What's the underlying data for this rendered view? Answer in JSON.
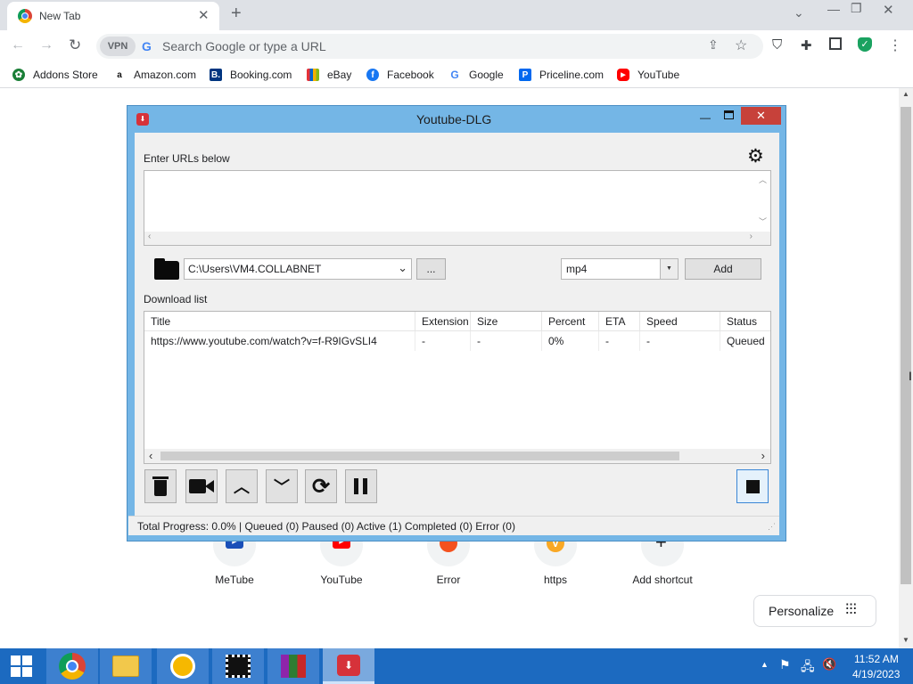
{
  "browser": {
    "tab_title": "New Tab",
    "omnibox_placeholder": "Search Google or type a URL",
    "vpn_label": "VPN",
    "bookmarks": [
      "Addons Store",
      "Amazon.com",
      "Booking.com",
      "eBay",
      "Facebook",
      "Google",
      "Priceline.com",
      "YouTube"
    ]
  },
  "new_tab": {
    "shortcuts": [
      "MeTube",
      "YouTube",
      "Error",
      "https",
      "Add shortcut"
    ],
    "personalize_label": "Personalize"
  },
  "dialog": {
    "title": "Youtube-DLG",
    "urls_label": "Enter URLs below",
    "urls_value": "",
    "path_value": "C:\\Users\\VM4.COLLABNET",
    "browse_label": "...",
    "format_value": "mp4",
    "add_label": "Add",
    "download_list_label": "Download list",
    "columns": [
      "Title",
      "Extension",
      "Size",
      "Percent",
      "ETA",
      "Speed",
      "Status"
    ],
    "rows": [
      {
        "title": "https://www.youtube.com/watch?v=f-R9IGvSLI4",
        "extension": "-",
        "size": "-",
        "percent": "0%",
        "eta": "-",
        "speed": "-",
        "status": "Queued"
      }
    ],
    "status_text": "Total Progress: 0.0% | Queued (0) Paused (0) Active (1) Completed (0) Error (0)"
  },
  "taskbar": {
    "time": "11:52 AM",
    "date": "4/19/2023"
  },
  "colors": {
    "dialog_frame": "#74b6e6",
    "close_button": "#c7413a",
    "taskbar": "#1c6ac0",
    "youtube_red": "#ff0000"
  }
}
